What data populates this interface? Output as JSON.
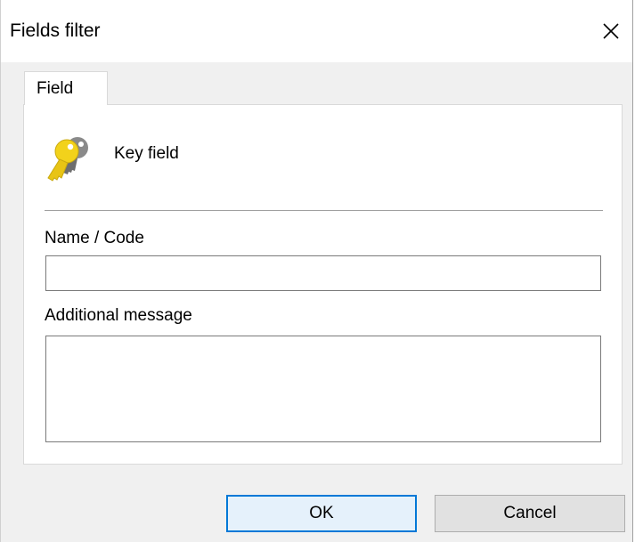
{
  "window": {
    "title": "Fields filter",
    "close_icon": "close-icon"
  },
  "tabs": [
    {
      "label": "Field",
      "selected": true
    }
  ],
  "field_tab": {
    "key_icon": "key-icon",
    "key_label": "Key field",
    "name_code_label": "Name / Code",
    "name_code_value": "",
    "additional_message_label": "Additional message",
    "additional_message_value": ""
  },
  "buttons": {
    "ok_label": "OK",
    "cancel_label": "Cancel"
  },
  "colors": {
    "ok_border": "#0078d7",
    "key_gold": "#f2d21b",
    "key_gray": "#7d7d7d"
  }
}
